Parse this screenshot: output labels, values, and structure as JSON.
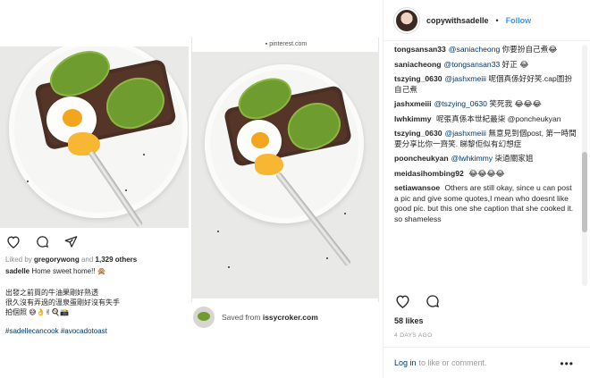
{
  "left_post": {
    "likes_prefix": "Liked by",
    "likes_user": "gregorywong",
    "likes_and": "and",
    "likes_others": "1,329 others",
    "caption_user": "sadelle",
    "caption_text": "Home sweet home!! 🙊",
    "body_line1": "出發之前買的牛油果剛好熟透",
    "body_line2": "很久沒有弄過的溫泉蛋剛好沒有失手",
    "body_line3": "拍個照 😅👌✌🍳📸",
    "hashtags": "#sadellecancook #avocadotoast",
    "icons": [
      "heart-icon",
      "comment-icon",
      "share-icon"
    ]
  },
  "pinterest": {
    "url": "pinterest.com",
    "saved_prefix": "Saved from",
    "saved_source": "issycroker.com"
  },
  "right_panel": {
    "username": "copywithsadelle",
    "separator": "•",
    "follow_label": "Follow",
    "comments": [
      {
        "user": "tongsansan33",
        "mention": "@saniacheong",
        "text": "你要扮自己煮😂"
      },
      {
        "user": "saniacheong",
        "mention": "@tongsansan33",
        "text": "好正 😂"
      },
      {
        "user": "tszying_0630",
        "mention": "@jashxmeiii",
        "text": "呢個真係好好笑.cap圖扮自己煮"
      },
      {
        "user": "jashxmeiii",
        "mention": "@tszying_0630",
        "text": "笑死我 😂😂😂"
      },
      {
        "user": "lwhkimmy",
        "mention": "",
        "text": "呢張真係本世紀最柒 @poncheukyan"
      },
      {
        "user": "tszying_0630",
        "mention": "@jashxmeiii",
        "text": "無意見到個post, 第一時間要分享比你一齊笑. 睇黎佢似有幻想症"
      },
      {
        "user": "pooncheukyan",
        "mention": "@lwhkimmy",
        "text": "柒過關家姐"
      },
      {
        "user": "meidasihombing92",
        "mention": "",
        "text": "😂😂😂😂"
      },
      {
        "user": "setiawansoe",
        "mention": "",
        "text": "Others are still okay, since u can post a pic and give some quotes,I mean who doesnt like good pic. but this one she caption that she cooked it. so shameless"
      }
    ],
    "likes_label": "58 likes",
    "time_label": "4 DAYS AGO",
    "login_link": "Log in",
    "login_rest": "to like or comment.",
    "more_label": "•••",
    "icons": [
      "heart-icon",
      "comment-icon"
    ]
  }
}
